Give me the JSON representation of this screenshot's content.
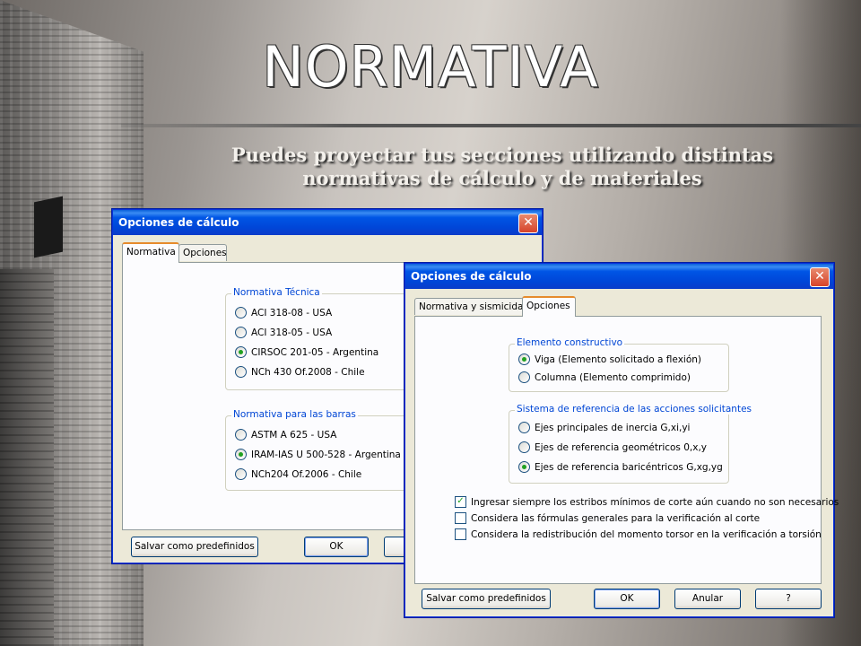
{
  "slide": {
    "title": "NORMATIVA",
    "subtitle_line1": "Puedes proyectar tus secciones utilizando distintas",
    "subtitle_line2": "normativas de cálculo y de materiales"
  },
  "dialog_back": {
    "title": "Opciones de cálculo",
    "tabs": [
      "Normativa",
      "Opciones"
    ],
    "active_tab": "Normativa",
    "group_tecnica": {
      "label": "Normativa Técnica",
      "options": [
        "ACI 318-08 - USA",
        "ACI 318-05 - USA",
        "CIRSOC 201-05 - Argentina",
        "NCh 430 Of.2008 - Chile"
      ],
      "selected": "CIRSOC 201-05 - Argentina"
    },
    "group_barras": {
      "label": "Normativa para las barras",
      "options": [
        "ASTM A 625 - USA",
        "IRAM-IAS U 500-528 - Argentina",
        "NCh204 Of.2006 - Chile"
      ],
      "selected": "IRAM-IAS U 500-528 - Argentina"
    },
    "btn_save": "Salvar como predefinidos",
    "btn_ok": "OK"
  },
  "dialog_front": {
    "title": "Opciones de cálculo",
    "tabs": [
      "Normativa y sismicidad",
      "Opciones"
    ],
    "active_tab": "Opciones",
    "group_elemento": {
      "label": "Elemento constructivo",
      "options": [
        "Viga (Elemento solicitado a flexión)",
        "Columna (Elemento comprimido)"
      ],
      "selected": "Viga (Elemento solicitado a flexión)"
    },
    "group_sistema": {
      "label": "Sistema de referencia de las acciones solicitantes",
      "options": [
        "Ejes principales de inercia G,xi,yi",
        "Ejes de referencia geométricos 0,x,y",
        "Ejes de referencia baricéntricos G,xg,yg"
      ],
      "selected": "Ejes de referencia baricéntricos G,xg,yg"
    },
    "checkboxes": [
      {
        "label": "Ingresar siempre los estribos mínimos de corte aún cuando no son necesarios",
        "checked": true
      },
      {
        "label": "Considera las fórmulas generales para la verificación al corte",
        "checked": false
      },
      {
        "label": "Considera la redistribución del momento torsor en la verificación a torsión",
        "checked": false
      }
    ],
    "btn_save": "Salvar como predefinidos",
    "btn_ok": "OK",
    "btn_cancel": "Anular",
    "btn_help": "?"
  }
}
